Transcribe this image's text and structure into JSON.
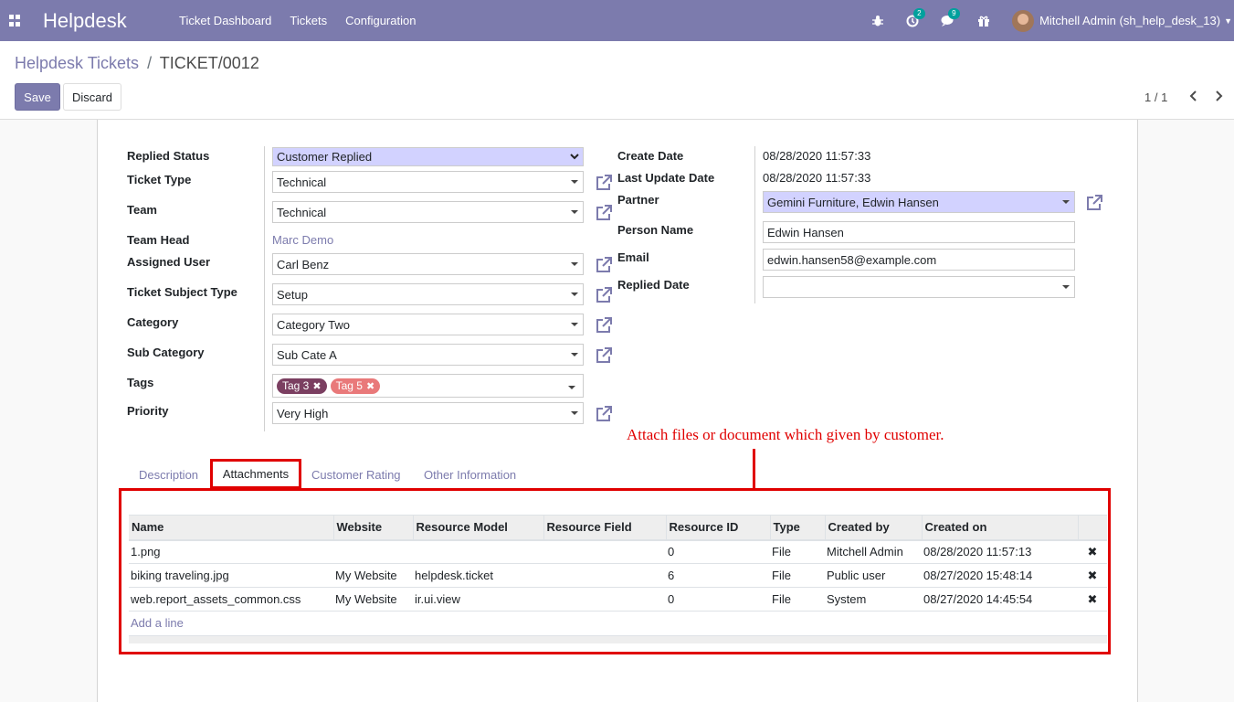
{
  "navbar": {
    "brand": "Helpdesk",
    "menu": [
      "Ticket Dashboard",
      "Tickets",
      "Configuration"
    ],
    "activity_badge": "2",
    "messages_badge": "9",
    "user": "Mitchell Admin (sh_help_desk_13)"
  },
  "breadcrumb": {
    "parent": "Helpdesk Tickets",
    "separator": "/",
    "current": "TICKET/0012"
  },
  "buttons": {
    "save": "Save",
    "discard": "Discard"
  },
  "pager": {
    "text": "1 / 1"
  },
  "left_fields": {
    "replied_status": {
      "label": "Replied Status",
      "value": "Customer Replied"
    },
    "ticket_type": {
      "label": "Ticket Type",
      "value": "Technical"
    },
    "team": {
      "label": "Team",
      "value": "Technical"
    },
    "team_head": {
      "label": "Team Head",
      "value": "Marc Demo"
    },
    "assigned_user": {
      "label": "Assigned User",
      "value": "Carl Benz"
    },
    "ticket_subject_type": {
      "label": "Ticket Subject Type",
      "value": "Setup"
    },
    "category": {
      "label": "Category",
      "value": "Category Two"
    },
    "sub_category": {
      "label": "Sub Category",
      "value": "Sub Cate A"
    },
    "tags": {
      "label": "Tags",
      "items": [
        {
          "name": "Tag 3",
          "color": "#7b3f61"
        },
        {
          "name": "Tag 5",
          "color": "#e9797a"
        }
      ]
    },
    "priority": {
      "label": "Priority",
      "value": "Very High"
    }
  },
  "right_fields": {
    "create_date": {
      "label": "Create Date",
      "value": "08/28/2020 11:57:33"
    },
    "last_update_date": {
      "label": "Last Update Date",
      "value": "08/28/2020 11:57:33"
    },
    "partner": {
      "label": "Partner",
      "value": "Gemini Furniture, Edwin Hansen"
    },
    "person_name": {
      "label": "Person Name",
      "value": "Edwin Hansen"
    },
    "email": {
      "label": "Email",
      "value": "edwin.hansen58@example.com"
    },
    "replied_date": {
      "label": "Replied Date",
      "value": ""
    }
  },
  "annotation": "Attach files or document which given by customer.",
  "tabs": [
    "Description",
    "Attachments",
    "Customer Rating",
    "Other Information"
  ],
  "attachments": {
    "columns": [
      "Name",
      "Website",
      "Resource Model",
      "Resource Field",
      "Resource ID",
      "Type",
      "Created by",
      "Created on"
    ],
    "rows": [
      [
        "1.png",
        "",
        "",
        "",
        "0",
        "File",
        "Mitchell Admin",
        "08/28/2020 11:57:13"
      ],
      [
        "biking traveling.jpg",
        "My Website",
        "helpdesk.ticket",
        "",
        "6",
        "File",
        "Public user",
        "08/27/2020 15:48:14"
      ],
      [
        "web.report_assets_common.css",
        "My Website",
        "ir.ui.view",
        "",
        "0",
        "File",
        "System",
        "08/27/2020 14:45:54"
      ]
    ],
    "add_line": "Add a line",
    "delete_symbol": "✖"
  },
  "colors": {
    "navbar": "#7c7bad",
    "annotation": "#e00000",
    "required_field": "#d2d2ff"
  }
}
